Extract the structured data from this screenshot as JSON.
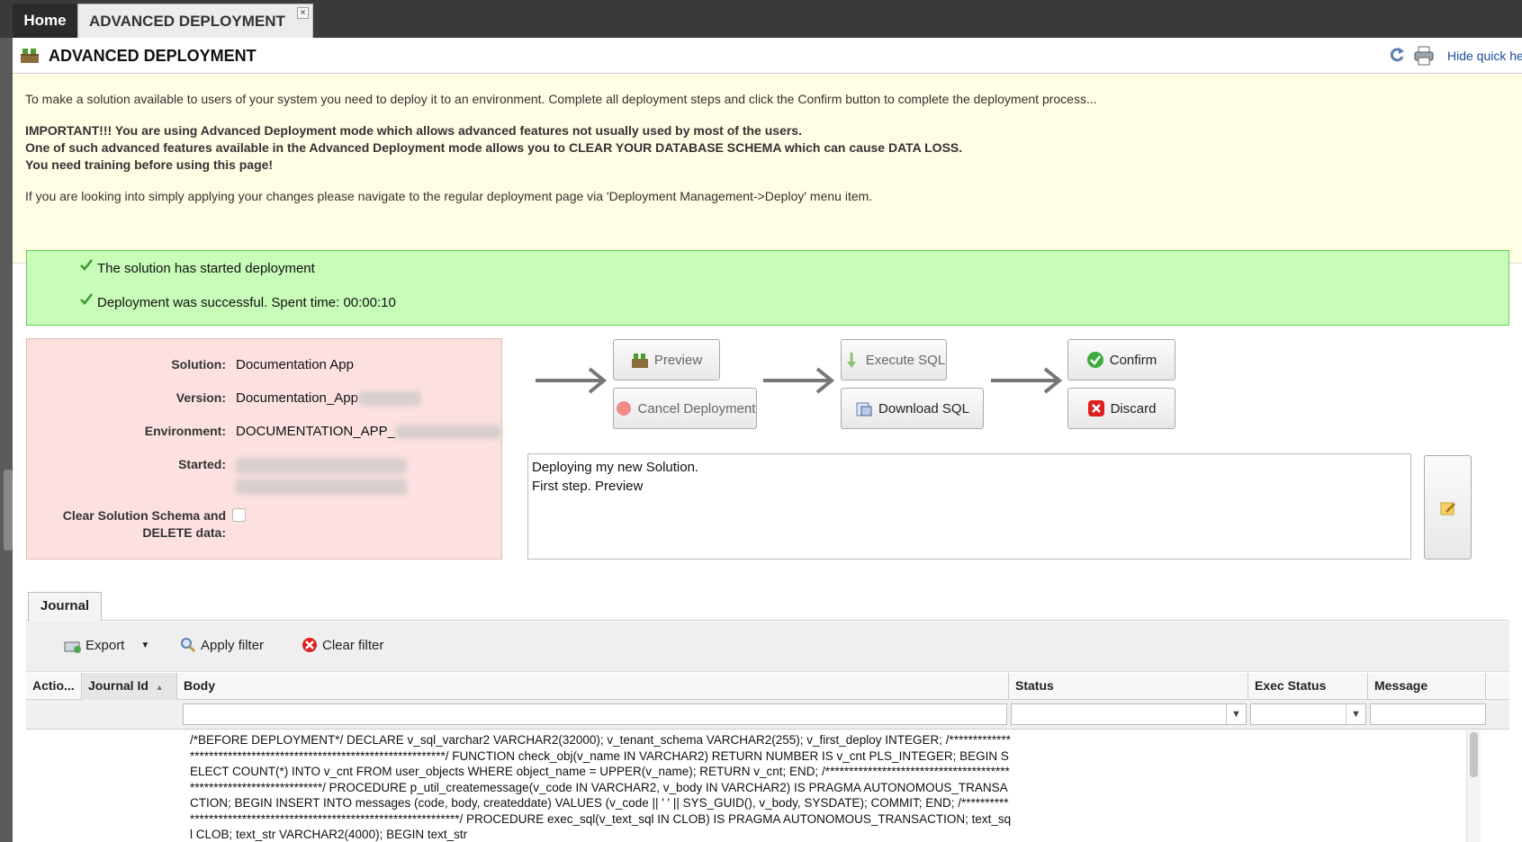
{
  "tabs": {
    "home": "Home",
    "active": "ADVANCED DEPLOYMENT",
    "close": "×"
  },
  "header": {
    "title": "ADVANCED DEPLOYMENT",
    "quick_help": "Hide quick help"
  },
  "notice": {
    "line1": "To make a solution available to users of your system you need to deploy it to an environment. Complete all deployment steps and click the Confirm button to complete the deployment process...",
    "important1": "IMPORTANT!!! You are using Advanced Deployment mode which allows advanced features not usually used by most of the users.",
    "important2": "One of such advanced features available in the Advanced Deployment mode allows you to CLEAR YOUR DATABASE SCHEMA which can cause DATA LOSS.",
    "important3": "You need training before using this page!",
    "line_last": "If you are looking into simply applying your changes please navigate to the regular deployment page via 'Deployment Management->Deploy' menu item."
  },
  "messages": {
    "started": "The solution has started deployment",
    "success": "Deployment was successful. Spent time: 00:00:10"
  },
  "info": {
    "solution_label": "Solution:",
    "solution_value": "Documentation App",
    "version_label": "Version:",
    "version_value": "Documentation_App",
    "environment_label": "Environment:",
    "environment_value": "DOCUMENTATION_APP_",
    "started_label": "Started:",
    "clear_label_1": "Clear Solution Schema and",
    "clear_label_2": "DELETE data:"
  },
  "actions": {
    "preview": "Preview",
    "cancel": "Cancel Deployment",
    "execute_sql": "Execute SQL",
    "download_sql": "Download SQL",
    "confirm": "Confirm",
    "discard": "Discard"
  },
  "notes": {
    "text": "Deploying my new Solution.\nFirst step. Preview"
  },
  "journal": {
    "tab": "Journal",
    "toolbar": {
      "export": "Export",
      "apply_filter": "Apply filter",
      "clear_filter": "Clear filter"
    },
    "columns": [
      "Actio...",
      "Journal Id",
      "Body",
      "Status",
      "Exec Status",
      "Message"
    ],
    "sort_indicator": "▲",
    "row_body": "/*BEFORE DEPLOYMENT*/ DECLARE v_sql_varchar2 VARCHAR2(32000); v_tenant_schema VARCHAR2(255); v_first_deploy INTEGER; /*******************************************************************/ FUNCTION check_obj(v_name IN VARCHAR2) RETURN NUMBER IS v_cnt PLS_INTEGER; BEGIN SELECT COUNT(*) INTO v_cnt FROM user_objects WHERE object_name = UPPER(v_name); RETURN v_cnt; END; /*******************************************************************/ PROCEDURE p_util_createmessage(v_code IN VARCHAR2, v_body IN VARCHAR2) IS PRAGMA AUTONOMOUS_TRANSACTION; BEGIN INSERT INTO messages (code, body, createddate) VALUES (v_code || ' ' || SYS_GUID(), v_body, SYSDATE); COMMIT; END; /*******************************************************************/ PROCEDURE exec_sql(v_text_sql IN CLOB) IS PRAGMA AUTONOMOUS_TRANSACTION; text_sql CLOB; text_str VARCHAR2(4000); BEGIN text_str"
  },
  "colors": {
    "success_bg": "#c8fcb9",
    "info_bg": "#fde1e1",
    "notice_bg": "#fffde3"
  }
}
